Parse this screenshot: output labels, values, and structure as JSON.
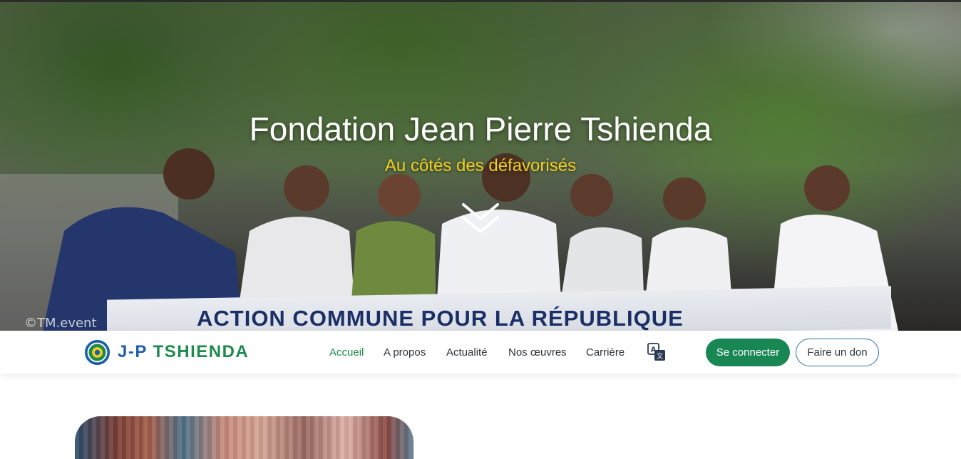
{
  "hero": {
    "title": "Fondation Jean Pierre Tshienda",
    "subtitle": "Au côtés des défavorisés",
    "banner_text": "ACTION COMMUNE POUR LA RÉPUBLIQUE",
    "watermark": "©TM.event",
    "scroll_icon": "double-chevron-down-icon"
  },
  "navbar": {
    "brand_prefix": "J-P",
    "brand_name": "TSHIENDA",
    "links": [
      {
        "label": "Accueil",
        "active": true
      },
      {
        "label": "A propos",
        "active": false
      },
      {
        "label": "Actualité",
        "active": false
      },
      {
        "label": "Nos œuvres",
        "active": false
      },
      {
        "label": "Carrière",
        "active": false
      }
    ],
    "language_icon": "translate-icon",
    "login_label": "Se connecter",
    "donate_label": "Faire un don"
  },
  "colors": {
    "primary_green": "#198754",
    "brand_blue": "#1f5fa8",
    "subtitle_yellow": "#f2cf1d",
    "active_link": "#1e8a4c"
  }
}
